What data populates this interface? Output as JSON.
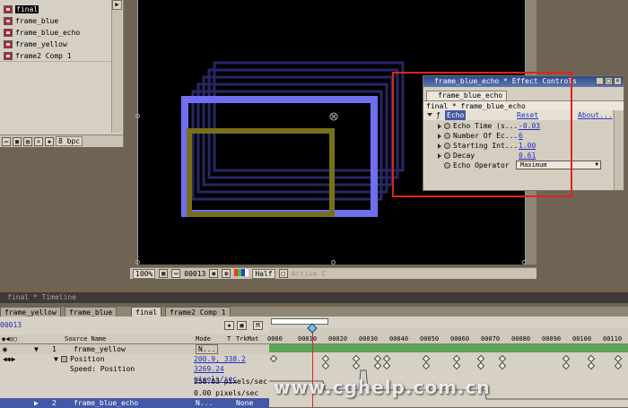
{
  "project": {
    "items": [
      {
        "label": "final",
        "selected": true
      },
      {
        "label": "frame_blue",
        "selected": false
      },
      {
        "label": "frame_blue_echo",
        "selected": false
      },
      {
        "label": "frame_yellow",
        "selected": false
      },
      {
        "label": "frame2 Comp 1",
        "selected": false
      }
    ],
    "bpc_label": "8 bpc"
  },
  "comp_bar": {
    "zoom": "100%",
    "timecode": "00013",
    "resolution": "Half",
    "camera": "Active C"
  },
  "effect_controls": {
    "title": "frame_blue_echo * Effect Controls",
    "tab": "frame_blue_echo",
    "breadcrumb": "final * frame_blue_echo",
    "effect_name": "Echo",
    "reset_label": "Reset",
    "about_label": "About...",
    "params": [
      {
        "name": "Echo Time (s...",
        "value": "-0.03"
      },
      {
        "name": "Number Of Ec...",
        "value": "6"
      },
      {
        "name": "Starting Int...",
        "value": "1.00"
      },
      {
        "name": "Decay",
        "value": "0.61"
      },
      {
        "name": "Echo Operator",
        "value": "Maximum"
      }
    ]
  },
  "timeline": {
    "title": "final * Timeline",
    "tabs": [
      "frame_yellow",
      "frame_blue",
      "final",
      "frame2 Comp 1"
    ],
    "active_tab": "final",
    "current_time": "00013",
    "columns": {
      "source_name": "Source Name",
      "mode": "Mode",
      "t": "T",
      "trkmat": "TrkMat"
    },
    "layers": [
      {
        "num": "1",
        "name": "frame_yellow",
        "mode": "N..."
      },
      {
        "num": "2",
        "name": "frame_blue_echo",
        "mode": "N...",
        "trkmat": "None"
      }
    ],
    "position": {
      "label": "Position",
      "value": "200.9, 338.2"
    },
    "speed": {
      "label": "Speed: Position",
      "value": "3269.24 pixels/sec",
      "low": "258.03 pixels/sec",
      "min": "0.00 pixels/sec"
    },
    "ruler_labels": [
      "0000",
      "00010",
      "00020",
      "00030",
      "00040",
      "00050",
      "00060",
      "00070",
      "00080",
      "00090",
      "00100",
      "00110"
    ],
    "kf_frames": [
      0,
      17,
      27,
      34,
      37,
      50,
      60,
      68,
      75,
      96,
      104,
      113
    ]
  },
  "watermark": "www.cghelp.com.cn",
  "colors": {
    "blue_frame": "#6f6ff0",
    "yellow_frame": "#77701a",
    "highlight_box": "#e0241d",
    "layer_bar": "#5aa655"
  }
}
